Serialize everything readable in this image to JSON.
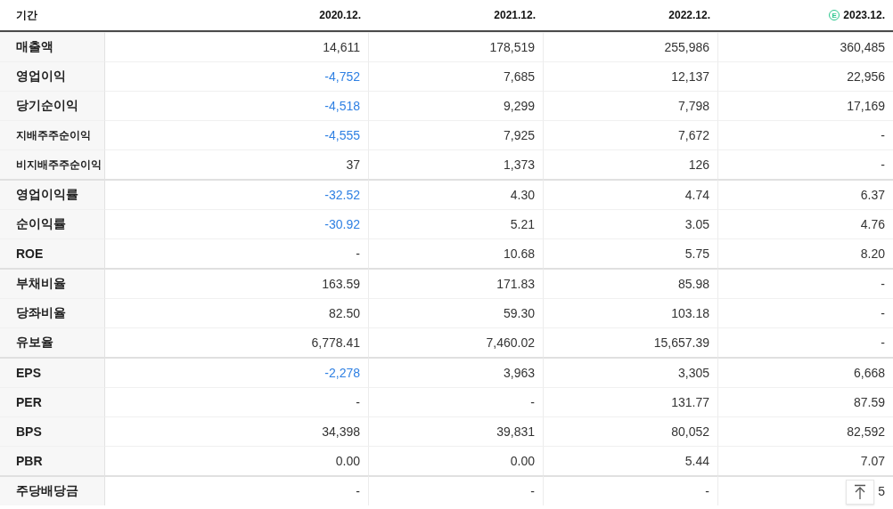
{
  "table": {
    "corner": "기간",
    "columns": [
      {
        "label": "2020.12."
      },
      {
        "label": "2021.12."
      },
      {
        "label": "2022.12."
      },
      {
        "label": "2023.12.",
        "badge": "E"
      }
    ],
    "groups": [
      {
        "rows": [
          {
            "label": "매출액",
            "kind": "main",
            "cells": [
              {
                "text": "14,611",
                "negative": false
              },
              {
                "text": "178,519",
                "negative": false
              },
              {
                "text": "255,986",
                "negative": false
              },
              {
                "text": "360,485",
                "negative": false
              }
            ]
          },
          {
            "label": "영업이익",
            "kind": "main",
            "cells": [
              {
                "text": "-4,752",
                "negative": true
              },
              {
                "text": "7,685",
                "negative": false
              },
              {
                "text": "12,137",
                "negative": false
              },
              {
                "text": "22,956",
                "negative": false
              }
            ]
          },
          {
            "label": "당기순이익",
            "kind": "main",
            "cells": [
              {
                "text": "-4,518",
                "negative": true
              },
              {
                "text": "9,299",
                "negative": false
              },
              {
                "text": "7,798",
                "negative": false
              },
              {
                "text": "17,169",
                "negative": false
              }
            ]
          },
          {
            "label": "지배주주순이익",
            "kind": "sub",
            "cells": [
              {
                "text": "-4,555",
                "negative": true
              },
              {
                "text": "7,925",
                "negative": false
              },
              {
                "text": "7,672",
                "negative": false
              },
              {
                "text": "-",
                "negative": false
              }
            ]
          },
          {
            "label": "비지배주주순이익",
            "kind": "sub",
            "cells": [
              {
                "text": "37",
                "negative": false
              },
              {
                "text": "1,373",
                "negative": false
              },
              {
                "text": "126",
                "negative": false
              },
              {
                "text": "-",
                "negative": false
              }
            ]
          }
        ]
      },
      {
        "rows": [
          {
            "label": "영업이익률",
            "kind": "main",
            "cells": [
              {
                "text": "-32.52",
                "negative": true
              },
              {
                "text": "4.30",
                "negative": false
              },
              {
                "text": "4.74",
                "negative": false
              },
              {
                "text": "6.37",
                "negative": false
              }
            ]
          },
          {
            "label": "순이익률",
            "kind": "main",
            "cells": [
              {
                "text": "-30.92",
                "negative": true
              },
              {
                "text": "5.21",
                "negative": false
              },
              {
                "text": "3.05",
                "negative": false
              },
              {
                "text": "4.76",
                "negative": false
              }
            ]
          },
          {
            "label": "ROE",
            "kind": "main",
            "cells": [
              {
                "text": "-",
                "negative": false
              },
              {
                "text": "10.68",
                "negative": false
              },
              {
                "text": "5.75",
                "negative": false
              },
              {
                "text": "8.20",
                "negative": false
              }
            ]
          }
        ]
      },
      {
        "rows": [
          {
            "label": "부채비율",
            "kind": "main",
            "cells": [
              {
                "text": "163.59",
                "negative": false
              },
              {
                "text": "171.83",
                "negative": false
              },
              {
                "text": "85.98",
                "negative": false
              },
              {
                "text": "-",
                "negative": false
              }
            ]
          },
          {
            "label": "당좌비율",
            "kind": "main",
            "cells": [
              {
                "text": "82.50",
                "negative": false
              },
              {
                "text": "59.30",
                "negative": false
              },
              {
                "text": "103.18",
                "negative": false
              },
              {
                "text": "-",
                "negative": false
              }
            ]
          },
          {
            "label": "유보율",
            "kind": "main",
            "cells": [
              {
                "text": "6,778.41",
                "negative": false
              },
              {
                "text": "7,460.02",
                "negative": false
              },
              {
                "text": "15,657.39",
                "negative": false
              },
              {
                "text": "-",
                "negative": false
              }
            ]
          }
        ]
      },
      {
        "rows": [
          {
            "label": "EPS",
            "kind": "main",
            "cells": [
              {
                "text": "-2,278",
                "negative": true
              },
              {
                "text": "3,963",
                "negative": false
              },
              {
                "text": "3,305",
                "negative": false
              },
              {
                "text": "6,668",
                "negative": false
              }
            ]
          },
          {
            "label": "PER",
            "kind": "main",
            "cells": [
              {
                "text": "-",
                "negative": false
              },
              {
                "text": "-",
                "negative": false
              },
              {
                "text": "131.77",
                "negative": false
              },
              {
                "text": "87.59",
                "negative": false
              }
            ]
          },
          {
            "label": "BPS",
            "kind": "main",
            "cells": [
              {
                "text": "34,398",
                "negative": false
              },
              {
                "text": "39,831",
                "negative": false
              },
              {
                "text": "80,052",
                "negative": false
              },
              {
                "text": "82,592",
                "negative": false
              }
            ]
          },
          {
            "label": "PBR",
            "kind": "main",
            "cells": [
              {
                "text": "0.00",
                "negative": false
              },
              {
                "text": "0.00",
                "negative": false
              },
              {
                "text": "5.44",
                "negative": false
              },
              {
                "text": "7.07",
                "negative": false
              }
            ]
          }
        ]
      },
      {
        "rows": [
          {
            "label": "주당배당금",
            "kind": "main",
            "cells": [
              {
                "text": "-",
                "negative": false
              },
              {
                "text": "-",
                "negative": false
              },
              {
                "text": "-",
                "negative": false
              },
              {
                "text": "5",
                "negative": false
              }
            ]
          }
        ]
      }
    ]
  }
}
